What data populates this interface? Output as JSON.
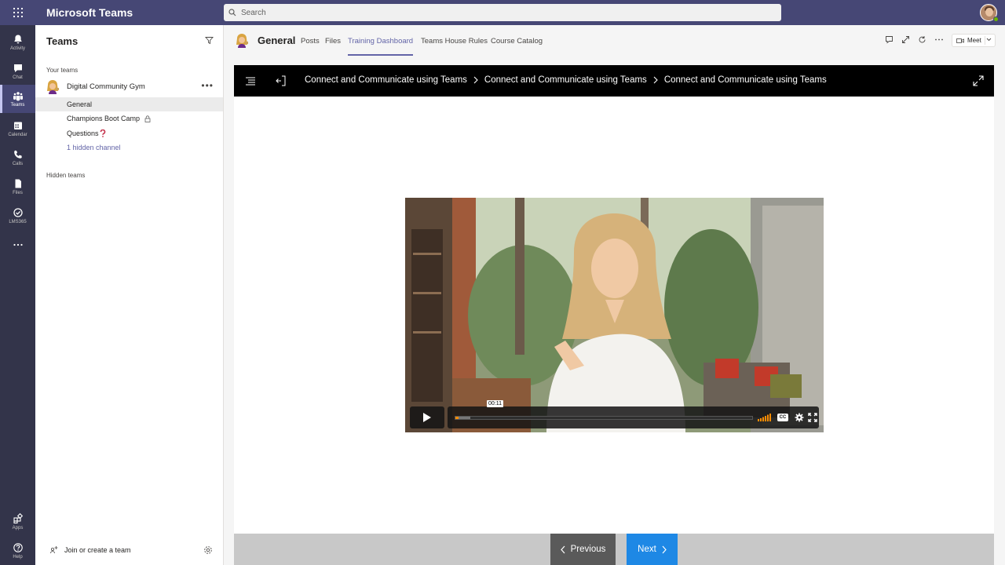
{
  "app": {
    "title": "Microsoft Teams"
  },
  "search": {
    "placeholder": "Search"
  },
  "rail": {
    "items": [
      {
        "label": "Activity",
        "icon": "bell-icon"
      },
      {
        "label": "Chat",
        "icon": "chat-icon"
      },
      {
        "label": "Teams",
        "icon": "teams-icon",
        "active": true
      },
      {
        "label": "Calendar",
        "icon": "calendar-icon"
      },
      {
        "label": "Calls",
        "icon": "phone-icon"
      },
      {
        "label": "Files",
        "icon": "file-icon"
      },
      {
        "label": "LMS365",
        "icon": "check-circle-icon"
      },
      {
        "label": "Apps",
        "icon": "apps-icon"
      },
      {
        "label": "Help",
        "icon": "help-icon"
      }
    ]
  },
  "panel": {
    "title": "Teams",
    "your_teams_label": "Your teams",
    "team_name": "Digital Community Gym",
    "channels": [
      {
        "label": "General",
        "selected": true
      },
      {
        "label": "Champions Boot Camp",
        "locked": true
      },
      {
        "label": "Questions"
      },
      {
        "label": "1 hidden channel"
      }
    ],
    "hidden_teams_label": "Hidden teams",
    "join_label": "Join or create a team"
  },
  "channel_header": {
    "title": "General",
    "tabs": [
      "Posts",
      "Files",
      "Training Dashboard",
      "Teams House Rules",
      "Course Catalog"
    ],
    "active_tab": "Training Dashboard",
    "meet_label": "Meet"
  },
  "course": {
    "breadcrumbs": [
      "Connect and Communicate using Teams",
      "Connect and Communicate using Teams",
      "Connect and Communicate using Teams"
    ],
    "video": {
      "time_tip": "00:11",
      "progress": 0.01,
      "buffered": 0.05,
      "cc_label": "CC"
    },
    "prev_label": "Previous",
    "next_label": "Next"
  },
  "colors": {
    "brand": "#464775",
    "rail": "#33344a",
    "accent": "#6264a7",
    "next_button": "#1e88e5",
    "prev_button": "#5a5a5a",
    "progress": "#ff8c00"
  }
}
